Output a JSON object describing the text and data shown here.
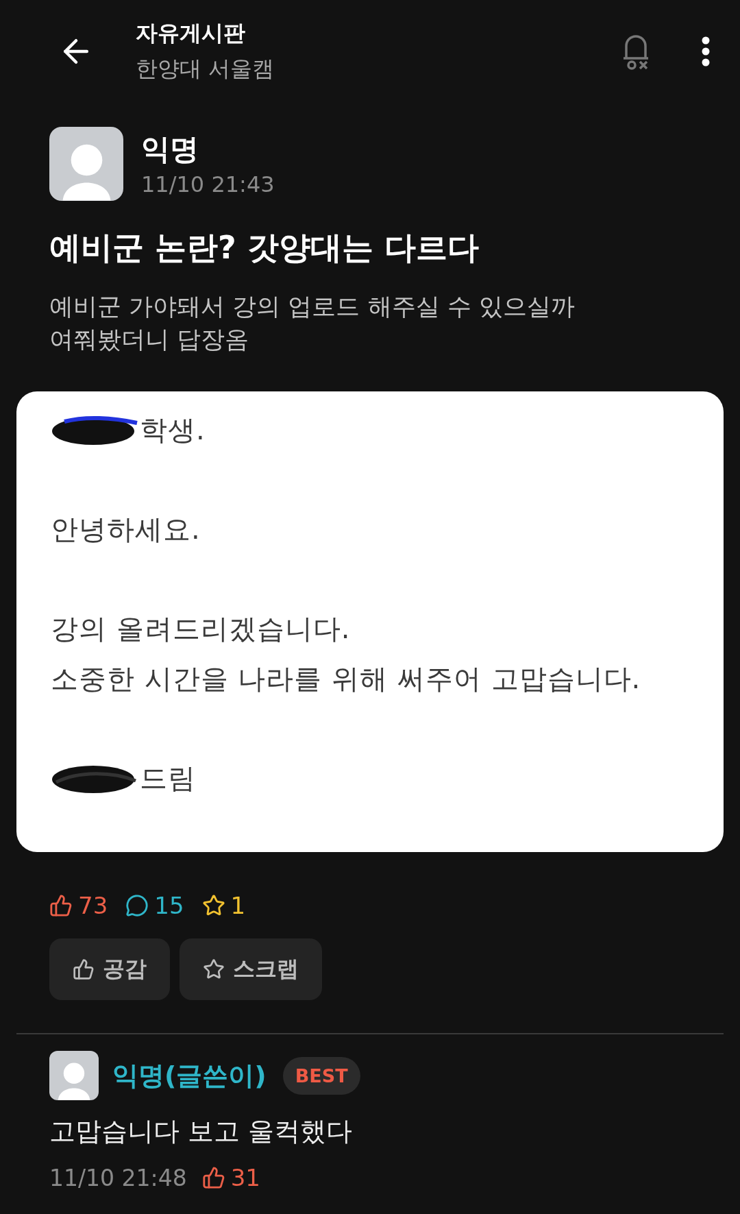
{
  "header": {
    "title": "자유게시판",
    "subtitle": "한양대 서울캠"
  },
  "post": {
    "author": "익명",
    "time": "11/10 21:43",
    "title": "예비군 논란? 갓양대는 다르다",
    "body": [
      "예비군 가야돼서 강의 업로드 해주실 수 있으실까",
      "여쭤봤더니 답장옴"
    ],
    "attachment": {
      "paragraphs": [
        {
          "lines": [
            {
              "text": "학생.",
              "redacted": true
            }
          ]
        },
        {
          "lines": [
            {
              "text": "안녕하세요.",
              "redacted": false
            }
          ]
        },
        {
          "lines": [
            {
              "text": "강의 올려드리겠습니다.",
              "redacted": false
            },
            {
              "text": "소중한 시간을 나라를 위해 써주어 고맙습니다.",
              "redacted": false
            }
          ]
        },
        {
          "lines": [
            {
              "text": "드림",
              "redacted": true
            }
          ]
        }
      ]
    },
    "stats": [
      {
        "kind": "like",
        "count": "73"
      },
      {
        "kind": "comment",
        "count": "15"
      },
      {
        "kind": "scrap",
        "count": "1"
      }
    ],
    "actions": [
      {
        "kind": "like",
        "label": "공감"
      },
      {
        "kind": "scrap",
        "label": "스크랩"
      }
    ]
  },
  "comments": [
    {
      "author": "익명(글쓴이)",
      "badge": "BEST",
      "text": "고맙습니다 보고 울컥했다",
      "time": "11/10 21:48",
      "likes": "31"
    }
  ]
}
